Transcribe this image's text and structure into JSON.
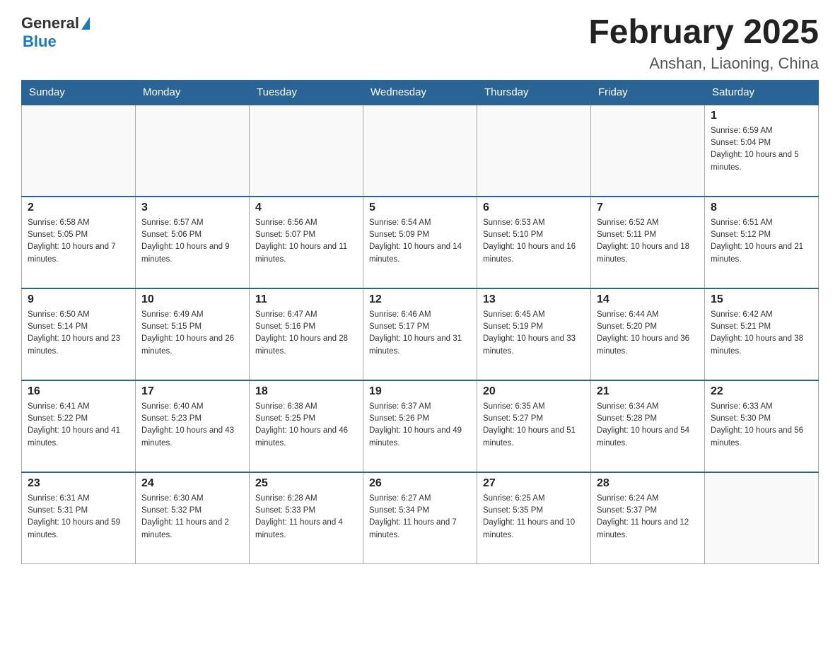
{
  "header": {
    "logo_general": "General",
    "logo_blue": "Blue",
    "title": "February 2025",
    "subtitle": "Anshan, Liaoning, China"
  },
  "days_of_week": [
    "Sunday",
    "Monday",
    "Tuesday",
    "Wednesday",
    "Thursday",
    "Friday",
    "Saturday"
  ],
  "weeks": [
    [
      {
        "day": "",
        "sunrise": "",
        "sunset": "",
        "daylight": ""
      },
      {
        "day": "",
        "sunrise": "",
        "sunset": "",
        "daylight": ""
      },
      {
        "day": "",
        "sunrise": "",
        "sunset": "",
        "daylight": ""
      },
      {
        "day": "",
        "sunrise": "",
        "sunset": "",
        "daylight": ""
      },
      {
        "day": "",
        "sunrise": "",
        "sunset": "",
        "daylight": ""
      },
      {
        "day": "",
        "sunrise": "",
        "sunset": "",
        "daylight": ""
      },
      {
        "day": "1",
        "sunrise": "Sunrise: 6:59 AM",
        "sunset": "Sunset: 5:04 PM",
        "daylight": "Daylight: 10 hours and 5 minutes."
      }
    ],
    [
      {
        "day": "2",
        "sunrise": "Sunrise: 6:58 AM",
        "sunset": "Sunset: 5:05 PM",
        "daylight": "Daylight: 10 hours and 7 minutes."
      },
      {
        "day": "3",
        "sunrise": "Sunrise: 6:57 AM",
        "sunset": "Sunset: 5:06 PM",
        "daylight": "Daylight: 10 hours and 9 minutes."
      },
      {
        "day": "4",
        "sunrise": "Sunrise: 6:56 AM",
        "sunset": "Sunset: 5:07 PM",
        "daylight": "Daylight: 10 hours and 11 minutes."
      },
      {
        "day": "5",
        "sunrise": "Sunrise: 6:54 AM",
        "sunset": "Sunset: 5:09 PM",
        "daylight": "Daylight: 10 hours and 14 minutes."
      },
      {
        "day": "6",
        "sunrise": "Sunrise: 6:53 AM",
        "sunset": "Sunset: 5:10 PM",
        "daylight": "Daylight: 10 hours and 16 minutes."
      },
      {
        "day": "7",
        "sunrise": "Sunrise: 6:52 AM",
        "sunset": "Sunset: 5:11 PM",
        "daylight": "Daylight: 10 hours and 18 minutes."
      },
      {
        "day": "8",
        "sunrise": "Sunrise: 6:51 AM",
        "sunset": "Sunset: 5:12 PM",
        "daylight": "Daylight: 10 hours and 21 minutes."
      }
    ],
    [
      {
        "day": "9",
        "sunrise": "Sunrise: 6:50 AM",
        "sunset": "Sunset: 5:14 PM",
        "daylight": "Daylight: 10 hours and 23 minutes."
      },
      {
        "day": "10",
        "sunrise": "Sunrise: 6:49 AM",
        "sunset": "Sunset: 5:15 PM",
        "daylight": "Daylight: 10 hours and 26 minutes."
      },
      {
        "day": "11",
        "sunrise": "Sunrise: 6:47 AM",
        "sunset": "Sunset: 5:16 PM",
        "daylight": "Daylight: 10 hours and 28 minutes."
      },
      {
        "day": "12",
        "sunrise": "Sunrise: 6:46 AM",
        "sunset": "Sunset: 5:17 PM",
        "daylight": "Daylight: 10 hours and 31 minutes."
      },
      {
        "day": "13",
        "sunrise": "Sunrise: 6:45 AM",
        "sunset": "Sunset: 5:19 PM",
        "daylight": "Daylight: 10 hours and 33 minutes."
      },
      {
        "day": "14",
        "sunrise": "Sunrise: 6:44 AM",
        "sunset": "Sunset: 5:20 PM",
        "daylight": "Daylight: 10 hours and 36 minutes."
      },
      {
        "day": "15",
        "sunrise": "Sunrise: 6:42 AM",
        "sunset": "Sunset: 5:21 PM",
        "daylight": "Daylight: 10 hours and 38 minutes."
      }
    ],
    [
      {
        "day": "16",
        "sunrise": "Sunrise: 6:41 AM",
        "sunset": "Sunset: 5:22 PM",
        "daylight": "Daylight: 10 hours and 41 minutes."
      },
      {
        "day": "17",
        "sunrise": "Sunrise: 6:40 AM",
        "sunset": "Sunset: 5:23 PM",
        "daylight": "Daylight: 10 hours and 43 minutes."
      },
      {
        "day": "18",
        "sunrise": "Sunrise: 6:38 AM",
        "sunset": "Sunset: 5:25 PM",
        "daylight": "Daylight: 10 hours and 46 minutes."
      },
      {
        "day": "19",
        "sunrise": "Sunrise: 6:37 AM",
        "sunset": "Sunset: 5:26 PM",
        "daylight": "Daylight: 10 hours and 49 minutes."
      },
      {
        "day": "20",
        "sunrise": "Sunrise: 6:35 AM",
        "sunset": "Sunset: 5:27 PM",
        "daylight": "Daylight: 10 hours and 51 minutes."
      },
      {
        "day": "21",
        "sunrise": "Sunrise: 6:34 AM",
        "sunset": "Sunset: 5:28 PM",
        "daylight": "Daylight: 10 hours and 54 minutes."
      },
      {
        "day": "22",
        "sunrise": "Sunrise: 6:33 AM",
        "sunset": "Sunset: 5:30 PM",
        "daylight": "Daylight: 10 hours and 56 minutes."
      }
    ],
    [
      {
        "day": "23",
        "sunrise": "Sunrise: 6:31 AM",
        "sunset": "Sunset: 5:31 PM",
        "daylight": "Daylight: 10 hours and 59 minutes."
      },
      {
        "day": "24",
        "sunrise": "Sunrise: 6:30 AM",
        "sunset": "Sunset: 5:32 PM",
        "daylight": "Daylight: 11 hours and 2 minutes."
      },
      {
        "day": "25",
        "sunrise": "Sunrise: 6:28 AM",
        "sunset": "Sunset: 5:33 PM",
        "daylight": "Daylight: 11 hours and 4 minutes."
      },
      {
        "day": "26",
        "sunrise": "Sunrise: 6:27 AM",
        "sunset": "Sunset: 5:34 PM",
        "daylight": "Daylight: 11 hours and 7 minutes."
      },
      {
        "day": "27",
        "sunrise": "Sunrise: 6:25 AM",
        "sunset": "Sunset: 5:35 PM",
        "daylight": "Daylight: 11 hours and 10 minutes."
      },
      {
        "day": "28",
        "sunrise": "Sunrise: 6:24 AM",
        "sunset": "Sunset: 5:37 PM",
        "daylight": "Daylight: 11 hours and 12 minutes."
      },
      {
        "day": "",
        "sunrise": "",
        "sunset": "",
        "daylight": ""
      }
    ]
  ]
}
